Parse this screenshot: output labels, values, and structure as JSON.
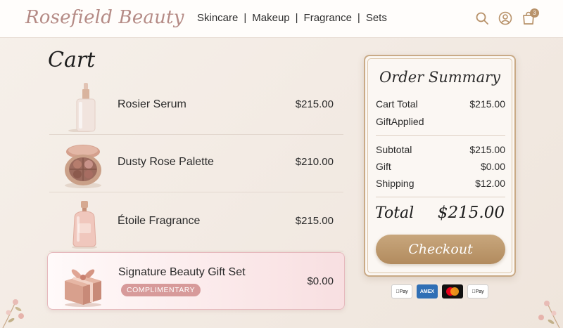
{
  "brand": {
    "logo": "Rosefield Beauty"
  },
  "nav": {
    "items": [
      "Skincare",
      "Makeup",
      "Fragrance",
      "Sets"
    ],
    "separator": "|"
  },
  "header": {
    "cart_count": "3"
  },
  "cart": {
    "title": "Cart",
    "items": [
      {
        "name": "Rosier Serum",
        "price": "$215.00"
      },
      {
        "name": "Dusty Rose Palette",
        "price": "$210.00"
      },
      {
        "name": "Étoile Fragrance",
        "price": "$215.00"
      }
    ],
    "gift": {
      "name": "Signature Beauty Gift Set",
      "badge": "COMPLIMENTARY",
      "price": "$0.00"
    }
  },
  "summary": {
    "title": "Order Summary",
    "cart_total_label": "Cart Total",
    "cart_total_value": "$215.00",
    "gift_applied_label": "GiftApplied",
    "subtotal_label": "Subtotal",
    "subtotal_value": "$215.00",
    "gift_label": "Gift",
    "gift_value": "$0.00",
    "shipping_label": "Shipping",
    "shipping_value": "$12.00",
    "total_label": "Total",
    "total_value": "$215.00",
    "checkout_label": "Checkout"
  },
  "payments": [
    {
      "icon": "apple-pay-icon",
      "label": "Pay"
    },
    {
      "icon": "amex-icon",
      "label": "AMEX"
    },
    {
      "icon": "mastercard-icon",
      "label": ""
    },
    {
      "icon": "apple-pay-icon",
      "label": "Pay"
    }
  ],
  "colors": {
    "accent": "#b8926a",
    "logo": "#b58b86",
    "badge_pink": "#d79a9a",
    "checkout": "#b28b5e"
  }
}
